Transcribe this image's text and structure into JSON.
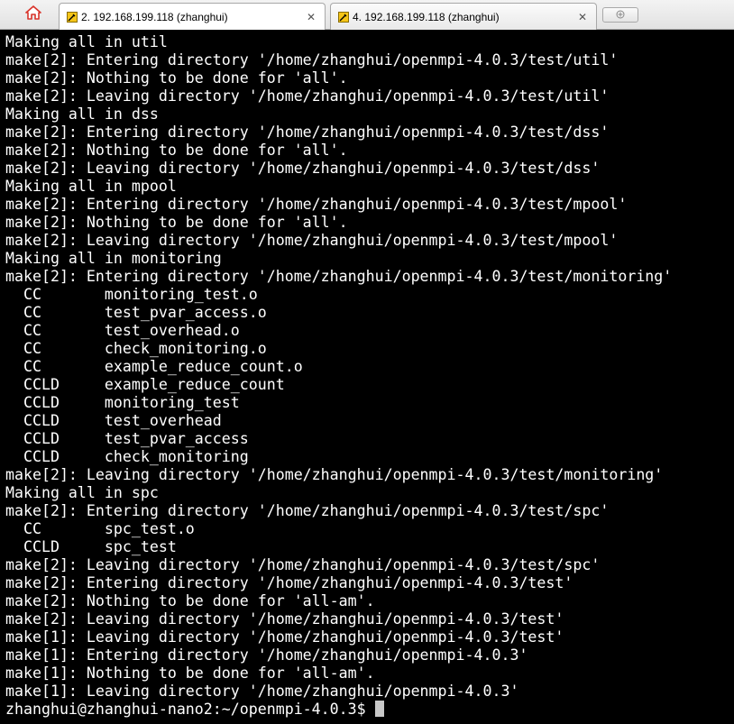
{
  "tabs": [
    {
      "label": "2. 192.168.199.118 (zhanghui)",
      "close": "✕",
      "active": true
    },
    {
      "label": "4. 192.168.199.118 (zhanghui)",
      "close": "✕",
      "active": false
    }
  ],
  "toolbar": {
    "home_icon": "home-icon",
    "new_tab_icon": "new-tab-icon"
  },
  "colors": {
    "terminal_bg": "#000000",
    "terminal_fg": "#ffffff",
    "tab_bar_bg": "#e6e6e6",
    "home_icon_red": "#d9342b",
    "tab_icon_yellow": "#f5c518"
  },
  "terminal": {
    "lines": [
      "Making all in util",
      "make[2]: Entering directory '/home/zhanghui/openmpi-4.0.3/test/util'",
      "make[2]: Nothing to be done for 'all'.",
      "make[2]: Leaving directory '/home/zhanghui/openmpi-4.0.3/test/util'",
      "Making all in dss",
      "make[2]: Entering directory '/home/zhanghui/openmpi-4.0.3/test/dss'",
      "make[2]: Nothing to be done for 'all'.",
      "make[2]: Leaving directory '/home/zhanghui/openmpi-4.0.3/test/dss'",
      "Making all in mpool",
      "make[2]: Entering directory '/home/zhanghui/openmpi-4.0.3/test/mpool'",
      "make[2]: Nothing to be done for 'all'.",
      "make[2]: Leaving directory '/home/zhanghui/openmpi-4.0.3/test/mpool'",
      "Making all in monitoring",
      "make[2]: Entering directory '/home/zhanghui/openmpi-4.0.3/test/monitoring'",
      "  CC       monitoring_test.o",
      "  CC       test_pvar_access.o",
      "  CC       test_overhead.o",
      "  CC       check_monitoring.o",
      "  CC       example_reduce_count.o",
      "  CCLD     example_reduce_count",
      "  CCLD     monitoring_test",
      "  CCLD     test_overhead",
      "  CCLD     test_pvar_access",
      "  CCLD     check_monitoring",
      "make[2]: Leaving directory '/home/zhanghui/openmpi-4.0.3/test/monitoring'",
      "Making all in spc",
      "make[2]: Entering directory '/home/zhanghui/openmpi-4.0.3/test/spc'",
      "  CC       spc_test.o",
      "  CCLD     spc_test",
      "make[2]: Leaving directory '/home/zhanghui/openmpi-4.0.3/test/spc'",
      "make[2]: Entering directory '/home/zhanghui/openmpi-4.0.3/test'",
      "make[2]: Nothing to be done for 'all-am'.",
      "make[2]: Leaving directory '/home/zhanghui/openmpi-4.0.3/test'",
      "make[1]: Leaving directory '/home/zhanghui/openmpi-4.0.3/test'",
      "make[1]: Entering directory '/home/zhanghui/openmpi-4.0.3'",
      "make[1]: Nothing to be done for 'all-am'.",
      "make[1]: Leaving directory '/home/zhanghui/openmpi-4.0.3'"
    ],
    "prompt": "zhanghui@zhanghui-nano2:~/openmpi-4.0.3$ "
  }
}
